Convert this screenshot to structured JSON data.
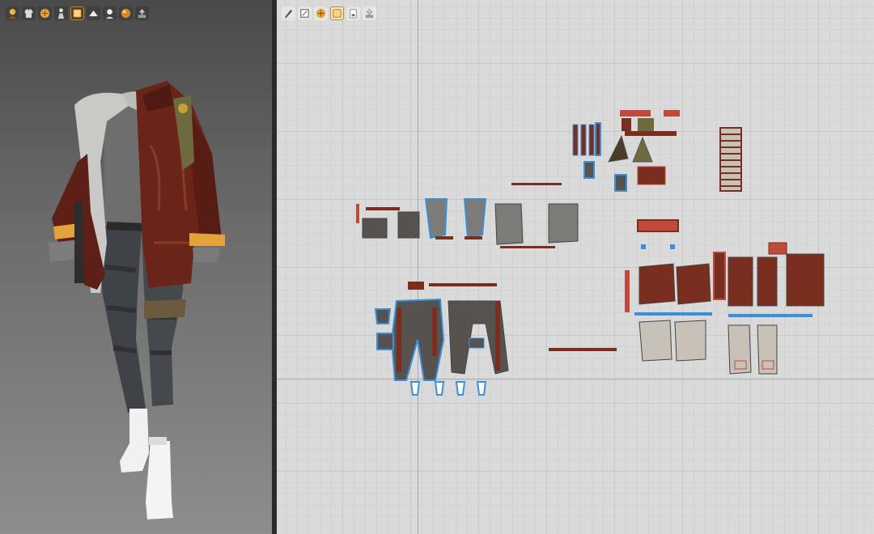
{
  "app": {
    "layout": "split",
    "accent_color": "#f4b340"
  },
  "viewport_3d": {
    "toolbar": [
      {
        "icon": "avatar-display-icon",
        "active": false
      },
      {
        "icon": "garment-display-icon",
        "active": false
      },
      {
        "icon": "fabric-texture-icon",
        "active": false
      },
      {
        "icon": "avatar-pose-icon",
        "active": false
      },
      {
        "icon": "texture-surface-icon",
        "active": true
      },
      {
        "icon": "render-view-icon",
        "active": false
      },
      {
        "icon": "avatar-silhouette-icon",
        "active": false
      },
      {
        "icon": "material-ball-icon",
        "active": false
      },
      {
        "icon": "export-icon",
        "active": false
      }
    ],
    "background_colors": [
      "#4a4a4a",
      "#8d8d8d"
    ],
    "outfit": {
      "jacket_color": "#6a2418",
      "hoodie_color": "#c9c9c5",
      "pants_color": "#3f4247",
      "shoes_color": "#f2f2f2",
      "cuff_color": "#e3a23a"
    }
  },
  "viewport_2d": {
    "toolbar": [
      {
        "icon": "pattern-edit-icon",
        "active": false
      },
      {
        "icon": "transform-pattern-icon",
        "active": false
      },
      {
        "icon": "fabric-texture-icon",
        "active": false
      },
      {
        "icon": "texture-surface-icon",
        "active": true
      },
      {
        "icon": "pattern-view-icon",
        "active": false
      },
      {
        "icon": "export-icon",
        "active": false
      }
    ],
    "background_color": "#dadada",
    "grid_color": "#c8c8c8",
    "pattern_colors": {
      "leather": "#7a2e1f",
      "grey_fabric": "#7d7b78",
      "denim": "#55524f",
      "light_fabric": "#c7c1b8",
      "seam_highlight": "#3a8fd6",
      "olive": "#6c6a3e",
      "trim_red": "#c04a3a"
    }
  }
}
